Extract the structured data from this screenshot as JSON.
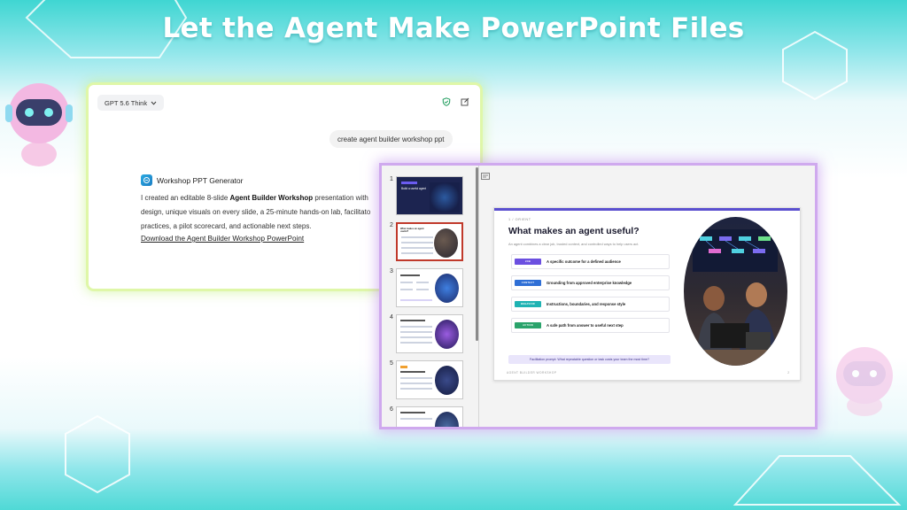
{
  "banner": {
    "title": "Let the Agent Make PowerPoint Files"
  },
  "chat": {
    "model_label": "GPT 5.6 Think",
    "model_chevron": "chevron-down-icon",
    "user_message": "create agent builder workshop ppt",
    "assistant_name": "Workshop PPT Generator",
    "assistant_line1_pre": "I created an editable 8-slide ",
    "assistant_line1_bold": "Agent Builder Workshop",
    "assistant_line1_post": " presentation with",
    "assistant_line2": "design, unique visuals on every slide, a 25-minute hands-on lab, facilitato",
    "assistant_line3": "practices, a pilot scorecard, and actionable next steps.",
    "download_link": "Download the Agent Builder Workshop PowerPoint"
  },
  "viewer": {
    "thumbnails": [
      {
        "number": "1",
        "title": "Build a useful agent"
      },
      {
        "number": "2",
        "title": "What makes an agent useful?"
      },
      {
        "number": "3",
        "title": ""
      },
      {
        "number": "4",
        "title": ""
      },
      {
        "number": "5",
        "title": ""
      },
      {
        "number": "6",
        "title": ""
      }
    ],
    "slide": {
      "kicker": "1 / ORIENT",
      "title": "What makes an agent useful?",
      "subtitle": "An agent combines a clear job, trusted context, and controlled ways to help users act.",
      "rows": [
        {
          "tag": "JOB",
          "text": "A specific outcome for a defined audience",
          "color": "#6b4fe0"
        },
        {
          "tag": "CONTEXT",
          "text": "Grounding from approved enterprise knowledge",
          "color": "#2f6fd6"
        },
        {
          "tag": "BEHAVIOR",
          "text": "Instructions, boundaries, and response style",
          "color": "#1fb3b3"
        },
        {
          "tag": "ACTION",
          "text": "A safe path from answer to useful next step",
          "color": "#2aa36b"
        }
      ],
      "prompt": "Facilitation prompt: What repeatable question or task costs your team the most time?",
      "footer": "AGENT BUILDER WORKSHOP",
      "page": "2"
    }
  },
  "colors": {
    "accent_purple": "#5a4fcf",
    "chat_glow": "#dff7a8",
    "viewer_glow": "#cfa9ee",
    "banner_teal": "#3fd6d2"
  }
}
